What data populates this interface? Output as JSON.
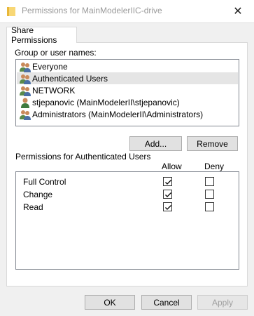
{
  "window": {
    "title": "Permissions for MainModelerIIC-drive",
    "close_glyph": "✕"
  },
  "tabs": [
    {
      "label": "Share Permissions",
      "selected": true
    }
  ],
  "group_section": {
    "label": "Group or user names:",
    "users": [
      {
        "label": "Everyone",
        "icon": "group-icon",
        "selected": false
      },
      {
        "label": "Authenticated Users",
        "icon": "group-icon",
        "selected": true
      },
      {
        "label": "NETWORK",
        "icon": "group-icon",
        "selected": false
      },
      {
        "label": "stjepanovic (MainModelerII\\stjepanovic)",
        "icon": "user-icon",
        "selected": false
      },
      {
        "label": "Administrators (MainModelerII\\Administrators)",
        "icon": "group-icon",
        "selected": false
      }
    ],
    "add_label": "Add...",
    "remove_label": "Remove"
  },
  "permissions": {
    "title": "Permissions for Authenticated Users",
    "allow_header": "Allow",
    "deny_header": "Deny",
    "rows": [
      {
        "name": "Full Control",
        "allow": true,
        "deny": false
      },
      {
        "name": "Change",
        "allow": true,
        "deny": false
      },
      {
        "name": "Read",
        "allow": true,
        "deny": false
      }
    ]
  },
  "footer": {
    "ok_label": "OK",
    "cancel_label": "Cancel",
    "apply_label": "Apply",
    "apply_enabled": false
  },
  "colors": {
    "dialog_bg": "#f0f0f0",
    "selection_bg": "#e5e5e5",
    "disabled_text": "#a0a0a0"
  }
}
